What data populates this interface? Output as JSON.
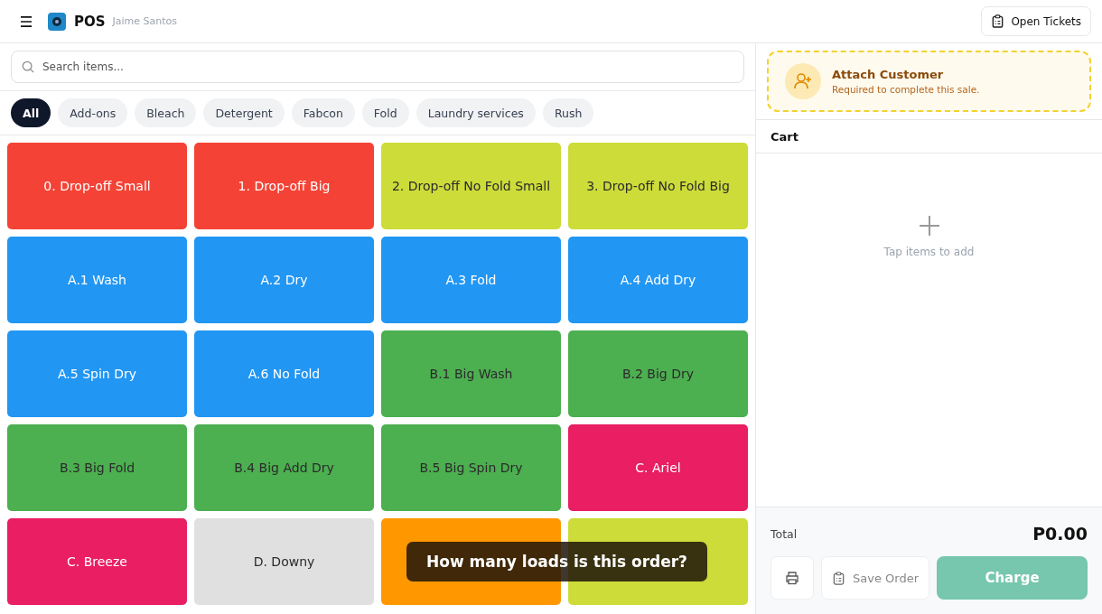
{
  "header": {
    "title": "POS",
    "user": "Jaime Santos",
    "open_tickets": "Open Tickets"
  },
  "search": {
    "placeholder": "Search items..."
  },
  "categories": [
    {
      "label": "All",
      "selected": true
    },
    {
      "label": "Add-ons",
      "selected": false
    },
    {
      "label": "Bleach",
      "selected": false
    },
    {
      "label": "Detergent",
      "selected": false
    },
    {
      "label": "Fabcon",
      "selected": false
    },
    {
      "label": "Fold",
      "selected": false
    },
    {
      "label": "Laundry services",
      "selected": false
    },
    {
      "label": "Rush",
      "selected": false
    }
  ],
  "items": [
    {
      "label": "0. Drop-off Small",
      "color": "#f44336"
    },
    {
      "label": "1. Drop-off Big",
      "color": "#f44336"
    },
    {
      "label": "2. Drop-off No Fold Small",
      "color": "#cddc39"
    },
    {
      "label": "3. Drop-off No Fold Big",
      "color": "#cddc39"
    },
    {
      "label": "A.1 Wash",
      "color": "#2196f3"
    },
    {
      "label": "A.2 Dry",
      "color": "#2196f3"
    },
    {
      "label": "A.3 Fold",
      "color": "#2196f3"
    },
    {
      "label": "A.4 Add Dry",
      "color": "#2196f3"
    },
    {
      "label": "A.5 Spin Dry",
      "color": "#2196f3"
    },
    {
      "label": "A.6 No Fold",
      "color": "#2196f3"
    },
    {
      "label": "B.1 Big Wash",
      "color": "#4caf50"
    },
    {
      "label": "B.2 Big Dry",
      "color": "#4caf50"
    },
    {
      "label": "B.3 Big Fold",
      "color": "#4caf50"
    },
    {
      "label": "B.4 Big Add Dry",
      "color": "#4caf50"
    },
    {
      "label": "B.5 Big Spin Dry",
      "color": "#4caf50"
    },
    {
      "label": "C. Ariel",
      "color": "#e91e63"
    },
    {
      "label": "C. Breeze",
      "color": "#e91e63"
    },
    {
      "label": "D. Downy",
      "color": "#e0e0e0"
    },
    {
      "color": "#ff9800"
    },
    {
      "color": "#cddc39"
    }
  ],
  "toast": "How many loads is this order?",
  "customer": {
    "title": "Attach Customer",
    "subtitle": "Required to complete this sale."
  },
  "cart": {
    "title": "Cart",
    "empty_hint": "Tap items to add"
  },
  "footer": {
    "total_label": "Total",
    "total": "P0.00",
    "save_order": "Save Order",
    "charge": "Charge"
  }
}
